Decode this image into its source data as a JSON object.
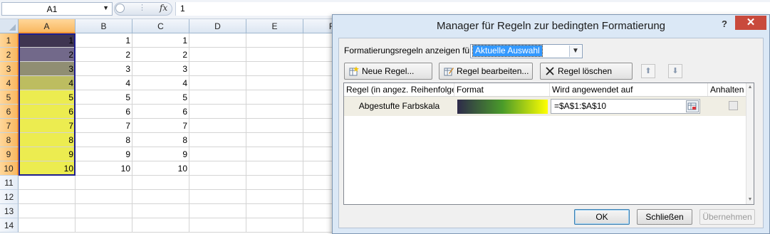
{
  "formula_bar": {
    "name_box": "A1",
    "fx_label": "fx",
    "formula_value": "1"
  },
  "sheet": {
    "columns": [
      "A",
      "B",
      "C",
      "D",
      "E",
      "F"
    ],
    "rows": [
      "1",
      "2",
      "3",
      "4",
      "5",
      "6",
      "7",
      "8",
      "9",
      "10",
      "11",
      "12",
      "13",
      "14"
    ],
    "col_a_values": [
      "1",
      "2",
      "3",
      "4",
      "5",
      "6",
      "7",
      "8",
      "9",
      "10"
    ],
    "col_b_values": [
      "1",
      "2",
      "3",
      "4",
      "5",
      "6",
      "7",
      "8",
      "9",
      "10"
    ],
    "col_c_values": [
      "1",
      "2",
      "3",
      "4",
      "5",
      "6",
      "7",
      "8",
      "9",
      "10"
    ],
    "col_a_fill_colors": [
      "#3f3551",
      "#72698a",
      "#908e73",
      "#bdbd60",
      "#ecec50",
      "#ecec50",
      "#ecec50",
      "#ecec50",
      "#ecec50",
      "#ecec50"
    ],
    "selection_color": "#1e1e8e"
  },
  "dialog": {
    "title": "Manager für Regeln zur bedingten Formatierung",
    "help_label": "?",
    "close_label": "✕",
    "show_rules_label": "Formatierungsregeln anzeigen für:",
    "show_rules_value": "Aktuelle Auswahl",
    "buttons": {
      "new_rule": "Neue Regel...",
      "edit_rule": "Regel bearbeiten...",
      "delete_rule": "Regel löschen",
      "ok": "OK",
      "close": "Schließen",
      "apply": "Übernehmen"
    },
    "table_headers": {
      "rule": "Regel (in angez. Reihenfolge)",
      "format": "Format",
      "applies_to": "Wird angewendet auf",
      "stop_if_true": "Anhalten"
    },
    "rules": [
      {
        "name": "Abgestufte Farbskala",
        "format_gradient": [
          "#2e2a4a",
          "#4a9b2a",
          "#ffff00"
        ],
        "applies_to": "=$A$1:$A$10",
        "stop_if_true": false
      }
    ]
  }
}
